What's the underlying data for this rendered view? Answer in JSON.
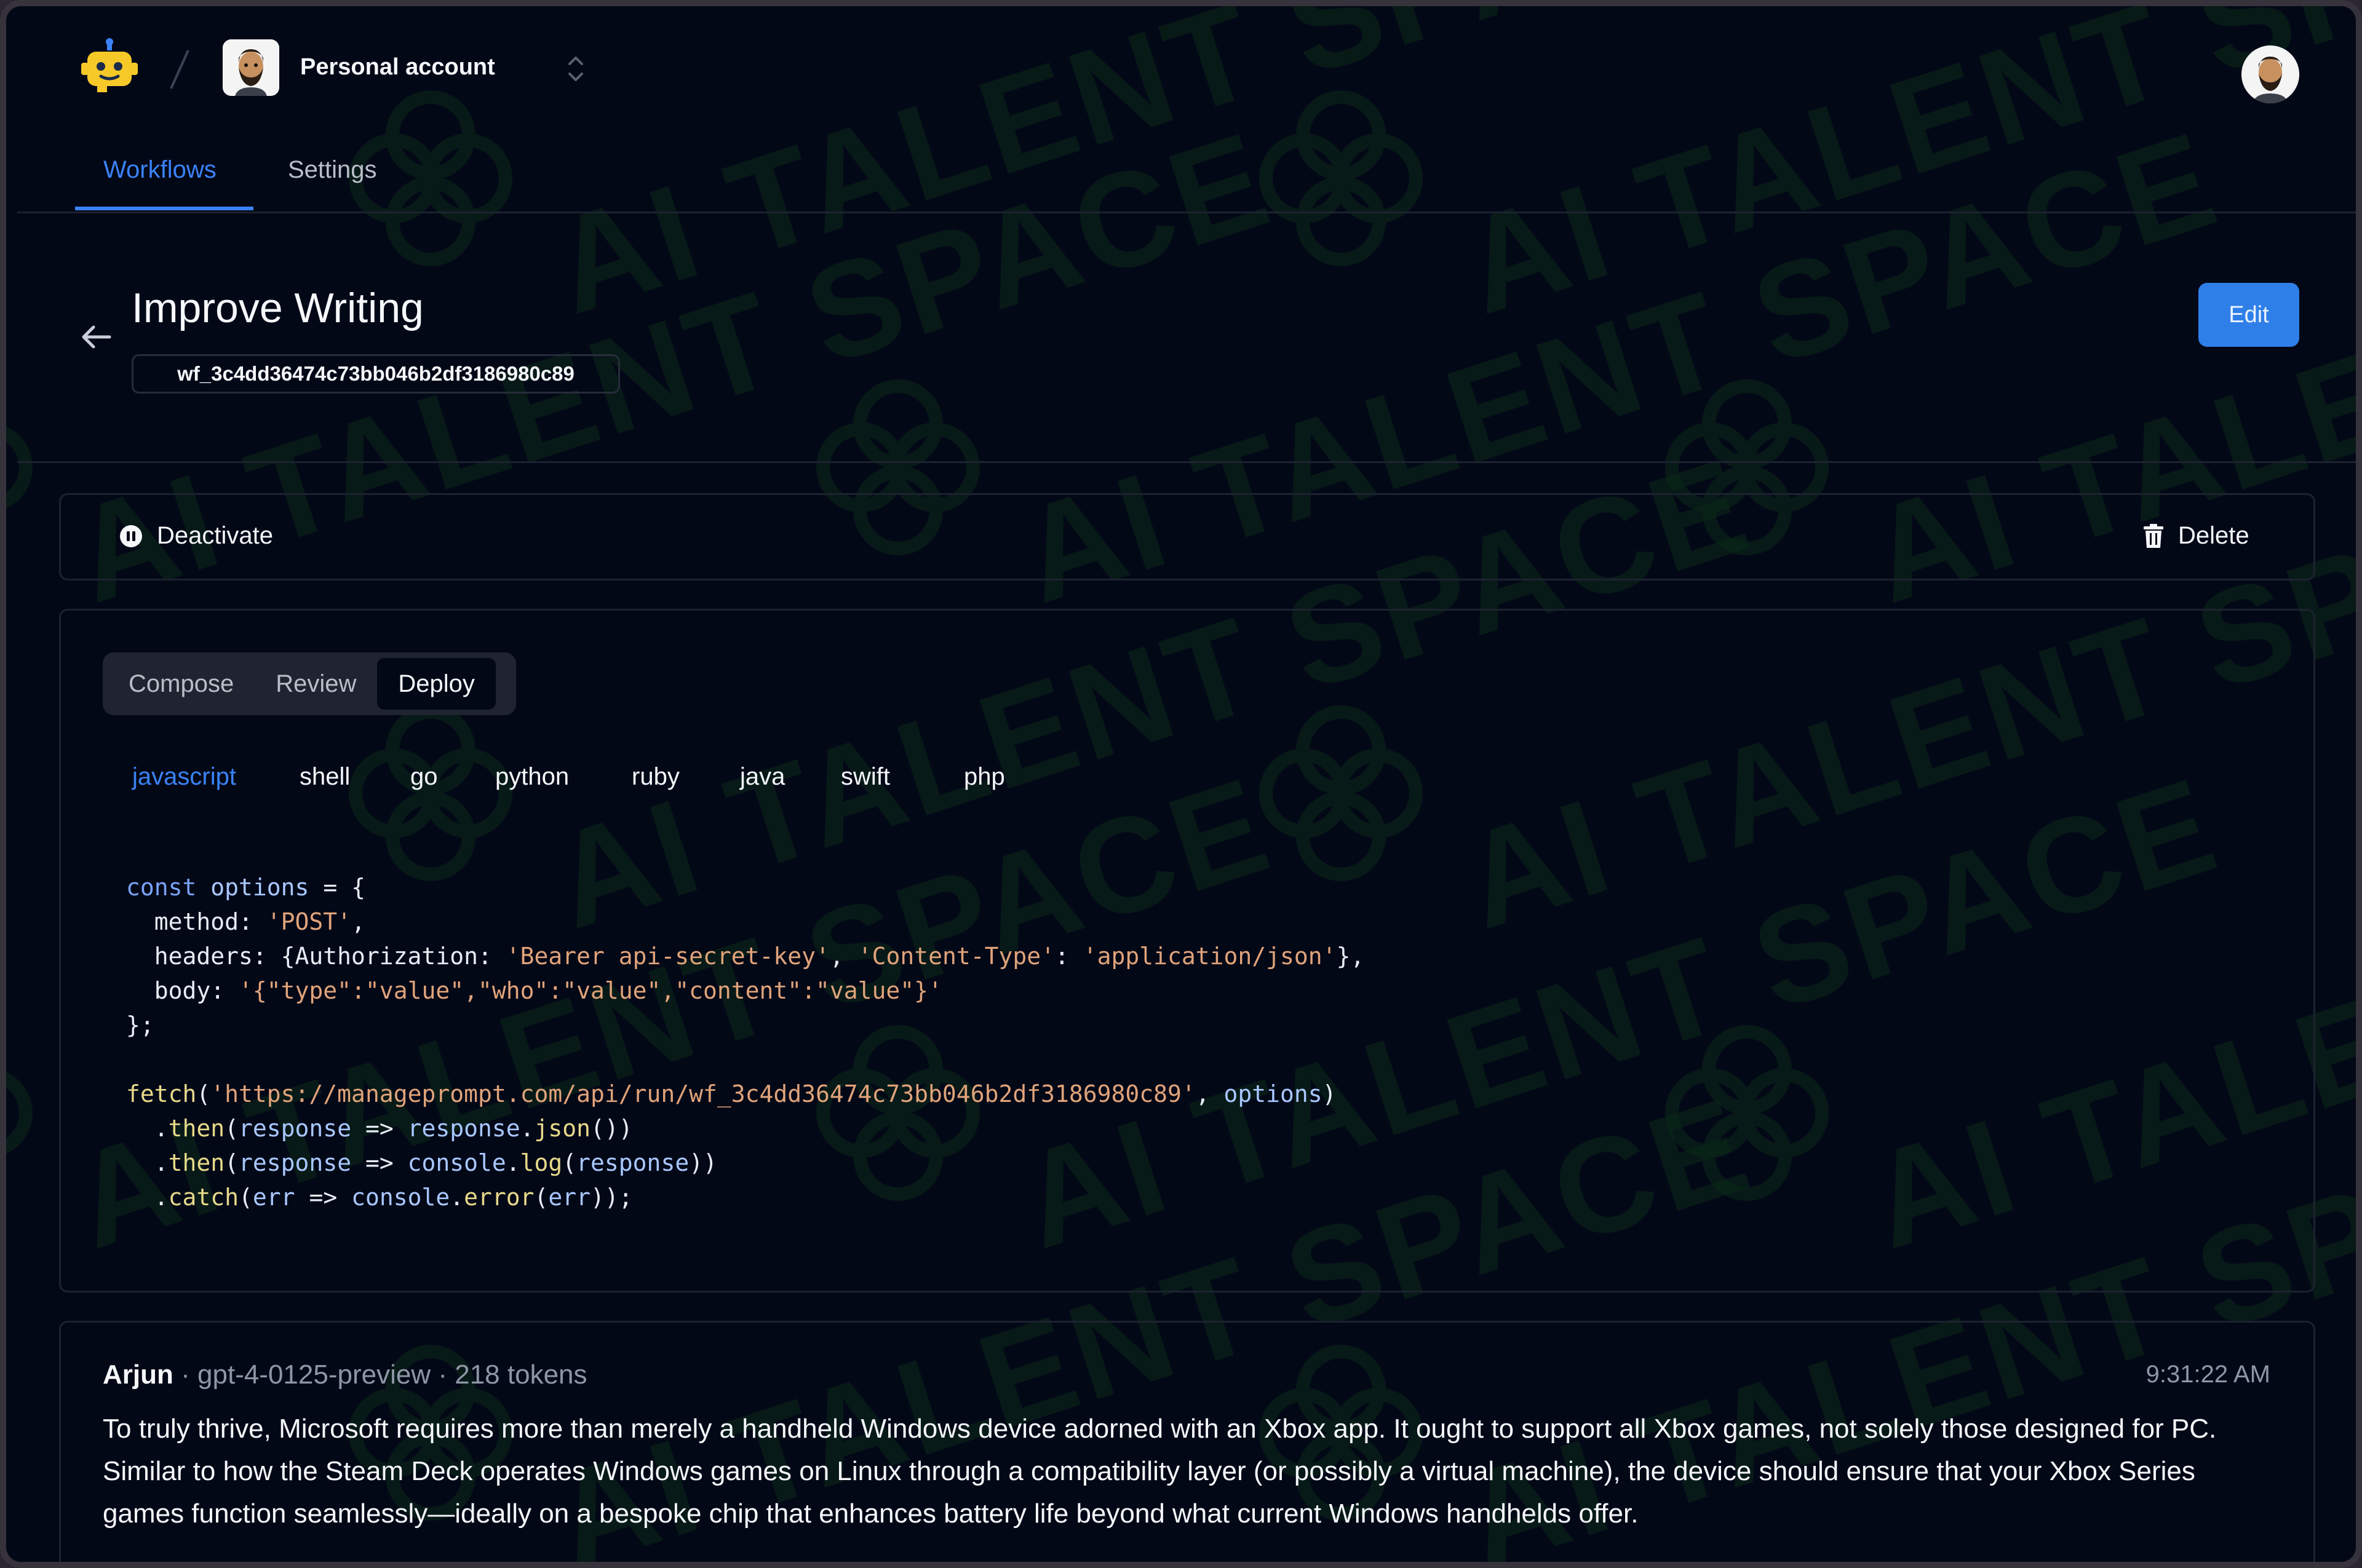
{
  "header": {
    "account_name": "Personal account",
    "separator": "/"
  },
  "nav": {
    "tabs": [
      {
        "label": "Workflows",
        "active": true
      },
      {
        "label": "Settings",
        "active": false
      }
    ]
  },
  "workflow": {
    "title": "Improve Writing",
    "id": "wf_3c4dd36474c73bb046b2df3186980c89",
    "edit_label": "Edit"
  },
  "actions": {
    "deactivate_label": "Deactivate",
    "delete_label": "Delete"
  },
  "modes": {
    "items": [
      "Compose",
      "Review",
      "Deploy"
    ],
    "active": "Deploy"
  },
  "languages": {
    "items": [
      "javascript",
      "shell",
      "go",
      "python",
      "ruby",
      "java",
      "swift",
      "php"
    ],
    "active": "javascript"
  },
  "code": {
    "lines": [
      "const options = {",
      "  method: 'POST',",
      "  headers: {Authorization: 'Bearer api-secret-key', 'Content-Type': 'application/json'},",
      "  body: '{\"type\":\"value\",\"who\":\"value\",\"content\":\"value\"}'",
      "};",
      "",
      "fetch('https://manageprompt.com/api/run/wf_3c4dd36474c73bb046b2df3186980c89', options)",
      "  .then(response => response.json())",
      "  .then(response => console.log(response))",
      "  .catch(err => console.error(err));"
    ]
  },
  "run": {
    "user": "Arjun",
    "model": "gpt-4-0125-preview",
    "tokens": "218 tokens",
    "time": "9:31:22 AM",
    "message": "To truly thrive, Microsoft requires more than merely a handheld Windows device adorned with an Xbox app. It ought to support all Xbox games, not solely those designed for PC. Similar to how the Steam Deck operates Windows games on Linux through a compatibility layer (or possibly a virtual machine), the device should ensure that your Xbox Series games function seamlessly—ideally on a bespoke chip that enhances battery life beyond what current Windows handhelds offer."
  },
  "watermark": {
    "text": "AI TALENT SPACE"
  },
  "colors": {
    "background": "#030817",
    "accent": "#3b82f6",
    "edit_button": "#2f7fe8",
    "border": "#1c2230",
    "watermark": "#0c2a17"
  }
}
